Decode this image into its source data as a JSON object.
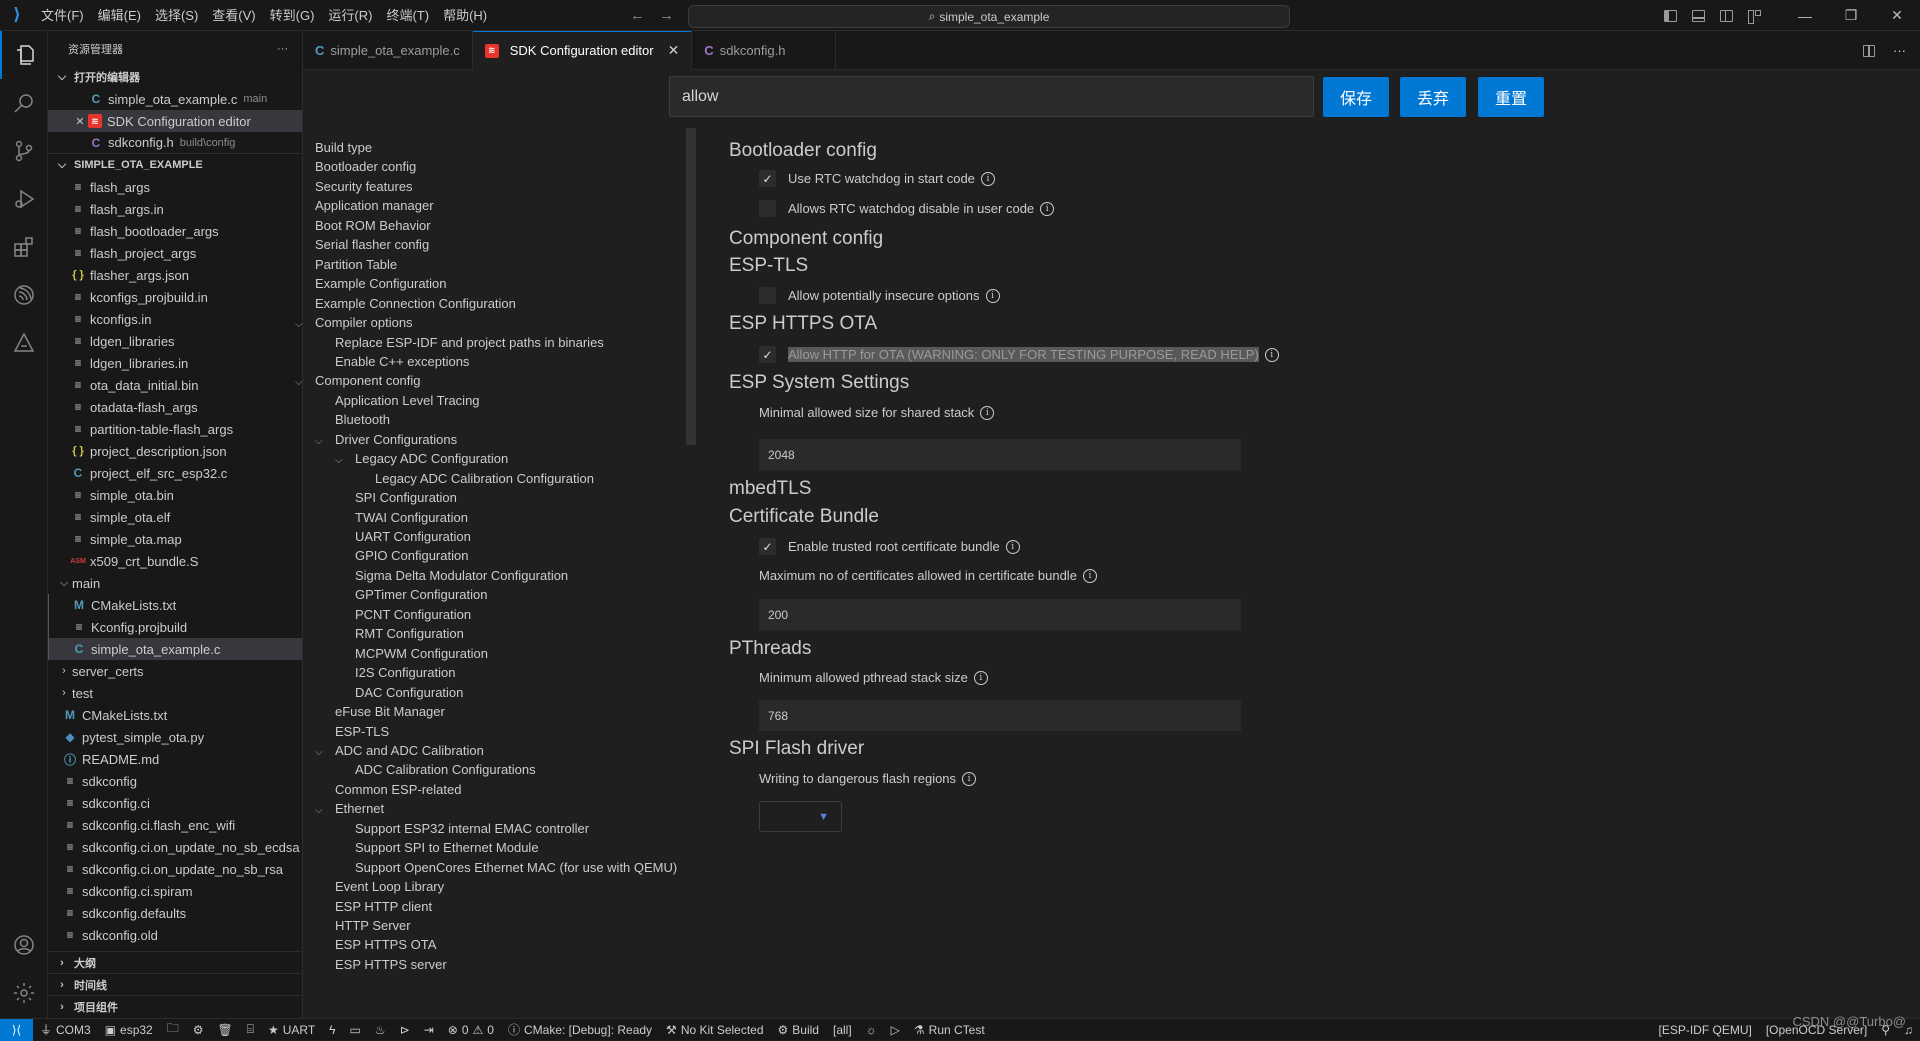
{
  "titlebar": {
    "menu": [
      "文件(F)",
      "编辑(E)",
      "选择(S)",
      "查看(V)",
      "转到(G)",
      "运行(R)",
      "终端(T)",
      "帮助(H)"
    ],
    "command_center": "simple_ota_example"
  },
  "sidebar": {
    "title": "资源管理器",
    "more": "···",
    "open_editors": {
      "label": "打开的编辑器",
      "items": [
        {
          "name": "simple_ota_example.c",
          "hint": "main"
        },
        {
          "name": "SDK Configuration editor",
          "hint": ""
        },
        {
          "name": "sdkconfig.h",
          "hint": "build\\config"
        }
      ]
    },
    "project": {
      "label": "SIMPLE_OTA_EXAMPLE",
      "files": [
        "flash_args",
        "flash_args.in",
        "flash_bootloader_args",
        "flash_project_args",
        "flasher_args.json",
        "kconfigs_projbuild.in",
        "kconfigs.in",
        "ldgen_libraries",
        "ldgen_libraries.in",
        "ota_data_initial.bin",
        "otadata-flash_args",
        "partition-table-flash_args",
        "project_description.json",
        "project_elf_src_esp32.c",
        "simple_ota.bin",
        "simple_ota.elf",
        "simple_ota.map",
        "x509_crt_bundle.S"
      ],
      "main_folder": "main",
      "main_files": [
        "CMakeLists.txt",
        "Kconfig.projbuild",
        "simple_ota_example.c"
      ],
      "folders": [
        "server_certs",
        "test"
      ],
      "root_files": [
        "CMakeLists.txt",
        "pytest_simple_ota.py",
        "README.md",
        "sdkconfig",
        "sdkconfig.ci",
        "sdkconfig.ci.flash_enc_wifi",
        "sdkconfig.ci.on_update_no_sb_ecdsa",
        "sdkconfig.ci.on_update_no_sb_rsa",
        "sdkconfig.ci.spiram",
        "sdkconfig.defaults",
        "sdkconfig.old"
      ]
    },
    "bottom_sections": [
      "大纲",
      "时间线",
      "项目组件"
    ]
  },
  "tabs": [
    {
      "label": "simple_ota_example.c",
      "icon": "C"
    },
    {
      "label": "SDK Configuration editor",
      "icon": "esp",
      "close": "✕"
    },
    {
      "label": "sdkconfig.h",
      "icon": "C"
    }
  ],
  "editor": {
    "search_value": "allow",
    "buttons": {
      "save": "保存",
      "discard": "丢弃",
      "reset": "重置"
    },
    "nav": [
      {
        "label": "Build type",
        "lvl": 0
      },
      {
        "label": "Bootloader config",
        "lvl": 0
      },
      {
        "label": "Security features",
        "lvl": 0
      },
      {
        "label": "Application manager",
        "lvl": 0
      },
      {
        "label": "Boot ROM Behavior",
        "lvl": 0
      },
      {
        "label": "Serial flasher config",
        "lvl": 0
      },
      {
        "label": "Partition Table",
        "lvl": 0
      },
      {
        "label": "Example Configuration",
        "lvl": 0
      },
      {
        "label": "Example Connection Configuration",
        "lvl": 0
      },
      {
        "label": "Compiler options",
        "lvl": 0,
        "exp": true
      },
      {
        "label": "Replace ESP-IDF and project paths in binaries",
        "lvl": 1
      },
      {
        "label": "Enable C++ exceptions",
        "lvl": 1
      },
      {
        "label": "Component config",
        "lvl": 0,
        "exp": true
      },
      {
        "label": "Application Level Tracing",
        "lvl": 1
      },
      {
        "label": "Bluetooth",
        "lvl": 1
      },
      {
        "label": "Driver Configurations",
        "lvl": 1,
        "exp": true
      },
      {
        "label": "Legacy ADC Configuration",
        "lvl": 2,
        "exp": true
      },
      {
        "label": "Legacy ADC Calibration Configuration",
        "lvl": 3
      },
      {
        "label": "SPI Configuration",
        "lvl": 2
      },
      {
        "label": "TWAI Configuration",
        "lvl": 2
      },
      {
        "label": "UART Configuration",
        "lvl": 2
      },
      {
        "label": "GPIO Configuration",
        "lvl": 2
      },
      {
        "label": "Sigma Delta Modulator Configuration",
        "lvl": 2
      },
      {
        "label": "GPTimer Configuration",
        "lvl": 2
      },
      {
        "label": "PCNT Configuration",
        "lvl": 2
      },
      {
        "label": "RMT Configuration",
        "lvl": 2
      },
      {
        "label": "MCPWM Configuration",
        "lvl": 2
      },
      {
        "label": "I2S Configuration",
        "lvl": 2
      },
      {
        "label": "DAC Configuration",
        "lvl": 2
      },
      {
        "label": "eFuse Bit Manager",
        "lvl": 1
      },
      {
        "label": "ESP-TLS",
        "lvl": 1
      },
      {
        "label": "ADC and ADC Calibration",
        "lvl": 1,
        "exp": true
      },
      {
        "label": "ADC Calibration Configurations",
        "lvl": 2
      },
      {
        "label": "Common ESP-related",
        "lvl": 1
      },
      {
        "label": "Ethernet",
        "lvl": 1,
        "exp": true
      },
      {
        "label": "Support ESP32 internal EMAC controller",
        "lvl": 2
      },
      {
        "label": "Support SPI to Ethernet Module",
        "lvl": 2
      },
      {
        "label": "Support OpenCores Ethernet MAC (for use with QEMU)",
        "lvl": 2
      },
      {
        "label": "Event Loop Library",
        "lvl": 1
      },
      {
        "label": "ESP HTTP client",
        "lvl": 1
      },
      {
        "label": "HTTP Server",
        "lvl": 1
      },
      {
        "label": "ESP HTTPS OTA",
        "lvl": 1
      },
      {
        "label": "ESP HTTPS server",
        "lvl": 1
      }
    ],
    "content": {
      "bootloader": {
        "title": "Bootloader config",
        "opt1": "Use RTC watchdog in start code",
        "opt1_checked": true,
        "opt2": "Allows RTC watchdog disable in user code",
        "opt2_checked": false
      },
      "component": {
        "title": "Component config"
      },
      "esptls": {
        "title": "ESP-TLS",
        "opt": "Allow potentially insecure options",
        "checked": false
      },
      "httpsota": {
        "title": "ESP HTTPS OTA",
        "opt": "Allow HTTP for OTA (WARNING: ONLY FOR TESTING PURPOSE, READ HELP)",
        "checked": true
      },
      "system": {
        "title": "ESP System Settings",
        "label": "Minimal allowed size for shared stack",
        "value": "2048"
      },
      "mbedtls": {
        "title": "mbedTLS"
      },
      "certbundle": {
        "title": "Certificate Bundle",
        "opt": "Enable trusted root certificate bundle",
        "checked": true,
        "label": "Maximum no of certificates allowed in certificate bundle",
        "value": "200"
      },
      "pthreads": {
        "title": "PThreads",
        "label": "Minimum allowed pthread stack size",
        "value": "768"
      },
      "spiflash": {
        "title": "SPI Flash driver",
        "label": "Writing to dangerous flash regions",
        "value": ""
      }
    },
    "check_glyph": "✓"
  },
  "statusbar": {
    "left": [
      "COM3",
      "esp32",
      "UART",
      "0",
      "0",
      "CMake: [Debug]: Ready",
      "No Kit Selected",
      "Build",
      "[all]",
      "Run CTest"
    ],
    "right": [
      "[ESP-IDF QEMU]",
      "[OpenOCD Server]"
    ],
    "watermark": "CSDN @@Turbo@"
  },
  "colors": {
    "accent": "#0078d4",
    "esp_red": "#e7352c"
  }
}
